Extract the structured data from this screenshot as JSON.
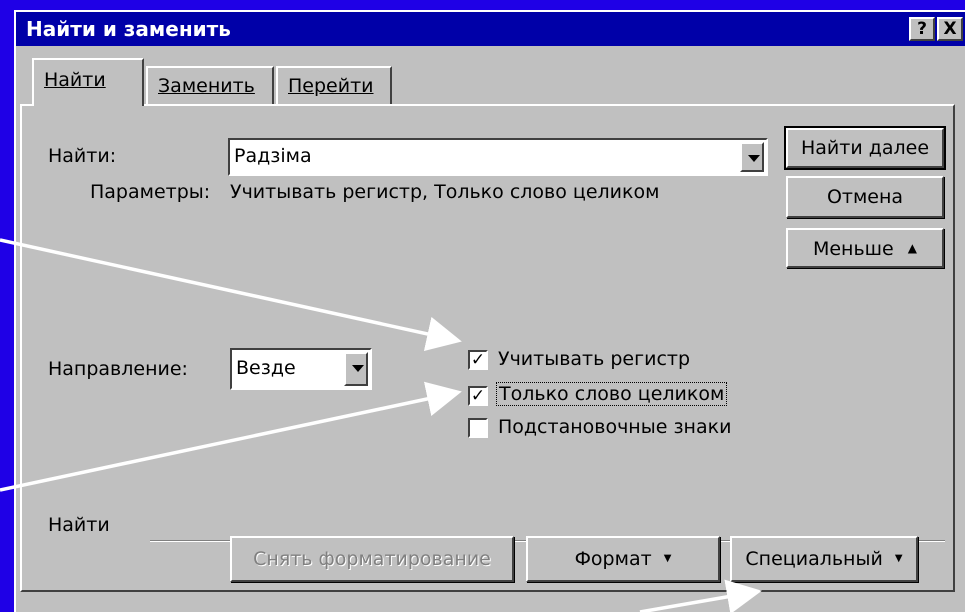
{
  "window": {
    "title": "Найти и заменить",
    "help_button": "?",
    "close_button": "X"
  },
  "tabs": [
    {
      "label": "Найти",
      "active": true
    },
    {
      "label": "Заменить",
      "active": false
    },
    {
      "label": "Перейти",
      "active": false
    }
  ],
  "find": {
    "label": "Найти:",
    "value": "Радзіма",
    "params_label": "Параметры:",
    "params_value": "Учитывать регистр, Только слово целиком"
  },
  "buttons": {
    "find_next": "Найти далее",
    "cancel": "Отмена",
    "less": "Меньше",
    "less_icon": "double-up-arrow-icon"
  },
  "direction": {
    "label": "Направление:",
    "value": "Везде"
  },
  "options": [
    {
      "label": "Учитывать регистр",
      "checked": true
    },
    {
      "label": "Только слово целиком",
      "checked": true
    },
    {
      "label": "Подстановочные знаки",
      "checked": false
    }
  ],
  "find_group": {
    "label": "Найти",
    "clear_formatting": "Снять форматирование",
    "format": "Формат",
    "special": "Специальный"
  },
  "colors": {
    "background": "#1f00e6",
    "titlebar": "#0000a8",
    "dialog": "#c0c0c0",
    "arrows": "#ffffff"
  }
}
